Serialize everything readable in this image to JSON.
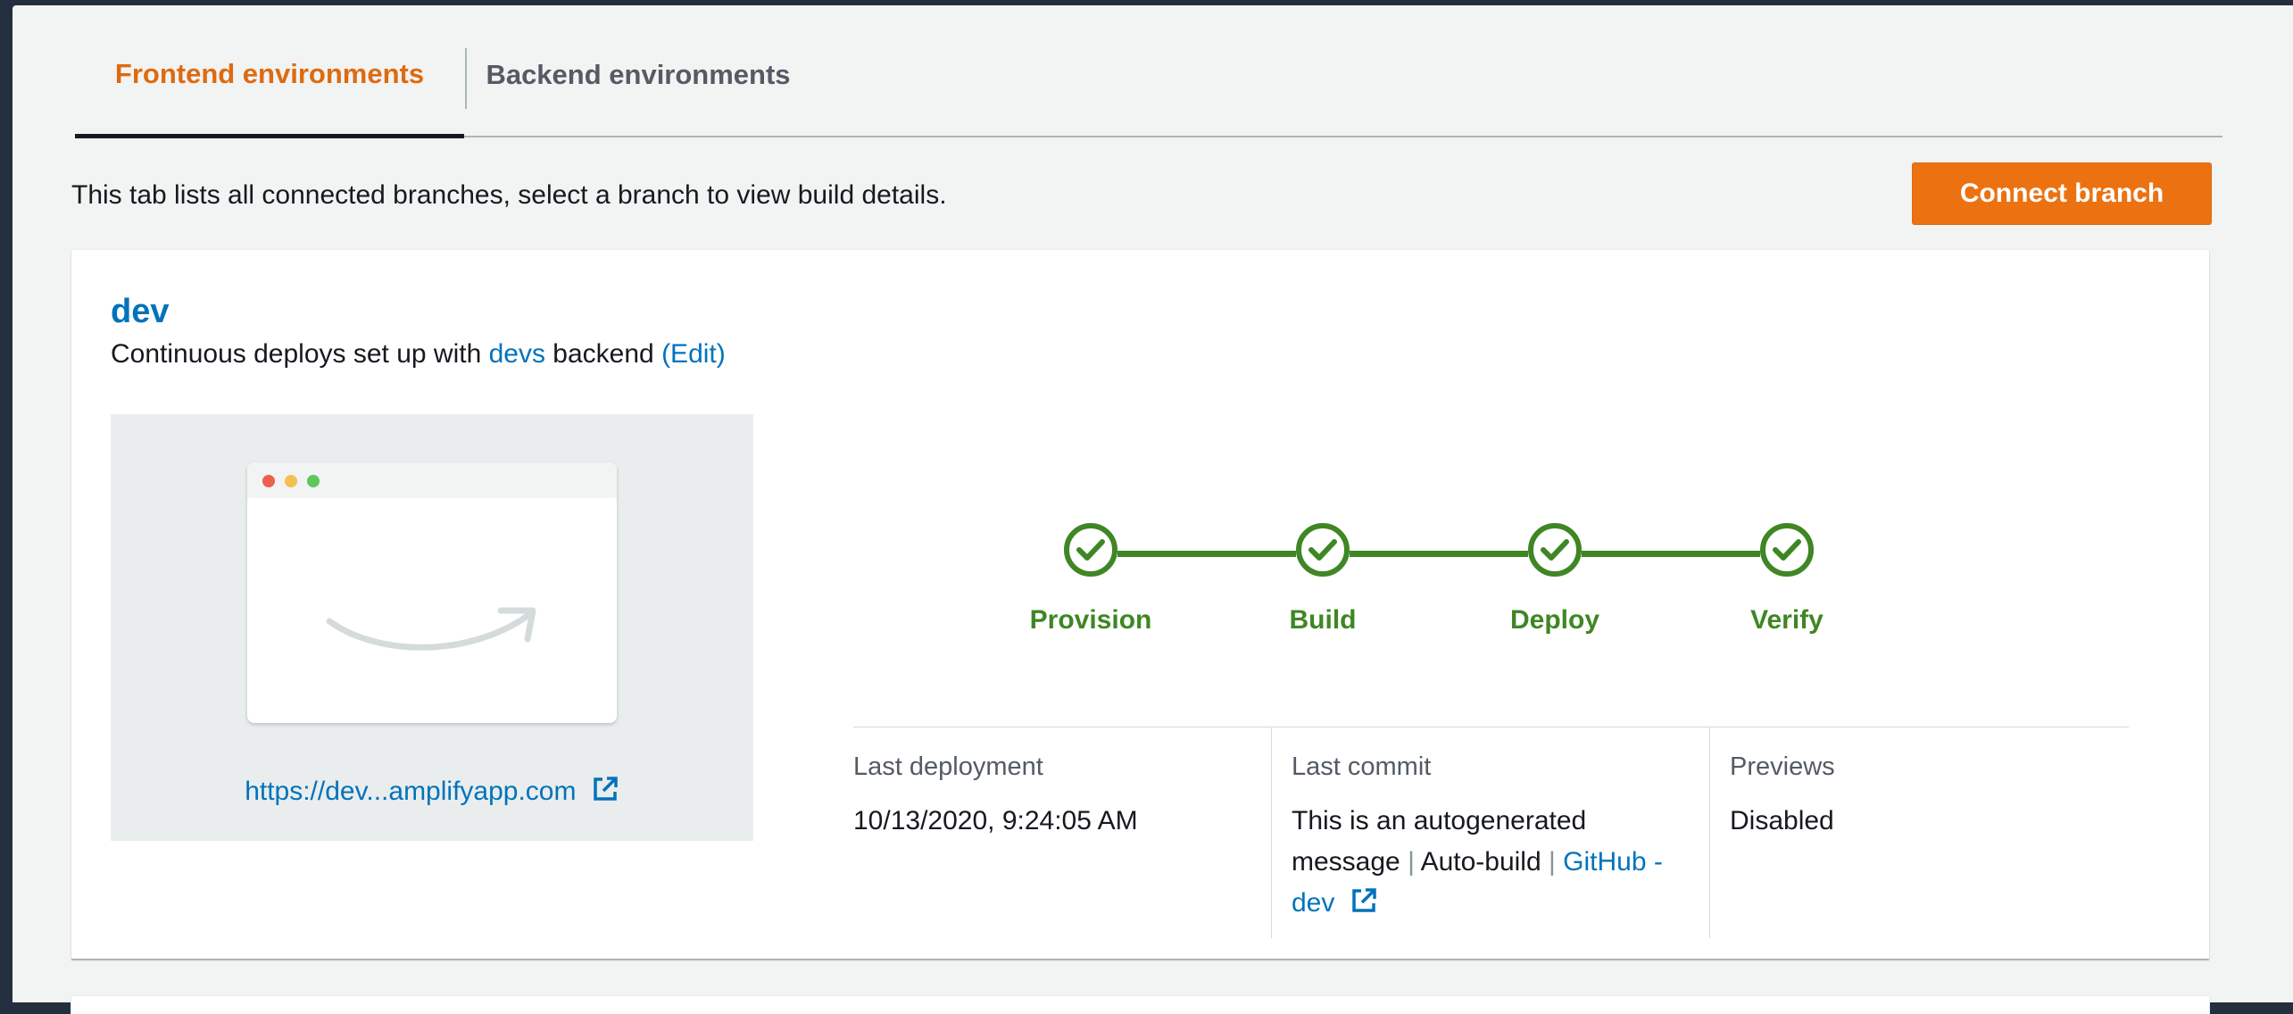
{
  "tabs": [
    {
      "label": "Frontend environments",
      "active": true
    },
    {
      "label": "Backend environments",
      "active": false
    }
  ],
  "intro_text": "This tab lists all connected branches, select a branch to view build details.",
  "connect_button": "Connect branch",
  "branch": {
    "name": "dev",
    "desc_prefix": "Continuous deploys set up with ",
    "backend_link": "devs",
    "desc_middle": " backend ",
    "edit_link": "(Edit)",
    "preview_url": "https://dev...amplifyapp.com"
  },
  "pipeline": {
    "color": "#3f8624",
    "steps": [
      {
        "label": "Provision",
        "status": "success",
        "icon": "check-icon"
      },
      {
        "label": "Build",
        "status": "success",
        "icon": "check-icon"
      },
      {
        "label": "Deploy",
        "status": "success",
        "icon": "check-icon"
      },
      {
        "label": "Verify",
        "status": "success",
        "icon": "check-icon"
      }
    ]
  },
  "details": {
    "last_deployment": {
      "label": "Last deployment",
      "value": "10/13/2020, 9:24:05 AM"
    },
    "last_commit": {
      "label": "Last commit",
      "message": "This is an autogenerated message",
      "separator": "|",
      "type": "Auto-build",
      "repo_link": "GitHub - dev"
    },
    "previews": {
      "label": "Previews",
      "value": "Disabled"
    }
  },
  "colors": {
    "accent": "#ec7211",
    "link": "#0073bb",
    "success": "#3f8624"
  }
}
